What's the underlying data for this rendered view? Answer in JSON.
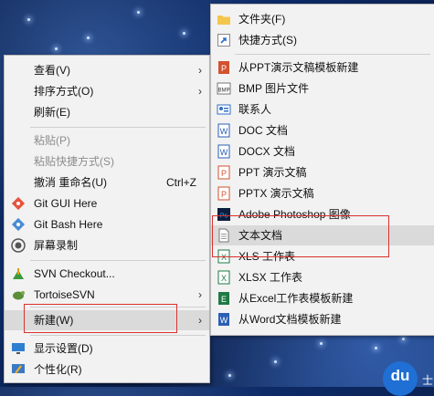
{
  "context_menu": {
    "items": [
      {
        "label": "查看(V)",
        "accel": "",
        "arrow": "›"
      },
      {
        "label": "排序方式(O)",
        "accel": "",
        "arrow": "›"
      },
      {
        "label": "刷新(E)",
        "accel": "",
        "arrow": ""
      },
      {
        "label": "粘贴(P)",
        "accel": "",
        "arrow": ""
      },
      {
        "label": "粘贴快捷方式(S)",
        "accel": "",
        "arrow": ""
      },
      {
        "label": "撤消 重命名(U)",
        "accel": "Ctrl+Z",
        "arrow": ""
      },
      {
        "label": "Git GUI Here",
        "accel": "",
        "arrow": ""
      },
      {
        "label": "Git Bash Here",
        "accel": "",
        "arrow": ""
      },
      {
        "label": "屏幕录制",
        "accel": "",
        "arrow": ""
      },
      {
        "label": "SVN Checkout...",
        "accel": "",
        "arrow": ""
      },
      {
        "label": "TortoiseSVN",
        "accel": "",
        "arrow": "›"
      },
      {
        "label": "新建(W)",
        "accel": "",
        "arrow": "›"
      },
      {
        "label": "显示设置(D)",
        "accel": "",
        "arrow": ""
      },
      {
        "label": "个性化(R)",
        "accel": "",
        "arrow": ""
      }
    ]
  },
  "new_submenu": {
    "items": [
      {
        "label": "文件夹(F)"
      },
      {
        "label": "快捷方式(S)"
      },
      {
        "label": "从PPT演示文稿模板新建"
      },
      {
        "label": "BMP 图片文件"
      },
      {
        "label": "联系人"
      },
      {
        "label": "DOC 文档"
      },
      {
        "label": "DOCX 文档"
      },
      {
        "label": "PPT 演示文稿"
      },
      {
        "label": "PPTX 演示文稿"
      },
      {
        "label": "Adobe Photoshop 图像"
      },
      {
        "label": "文本文档"
      },
      {
        "label": "XLS 工作表"
      },
      {
        "label": "XLSX 工作表"
      },
      {
        "label": "从Excel工作表模板新建"
      },
      {
        "label": "从Word文档模板新建"
      }
    ]
  },
  "corner_logo": {
    "text": "du",
    "tail": "士"
  },
  "colors": {
    "menu_bg": "#f2f2f2",
    "highlight": "#dadada",
    "annotation_red": "#d9312e",
    "desktop_blue": "#0d2a66"
  }
}
